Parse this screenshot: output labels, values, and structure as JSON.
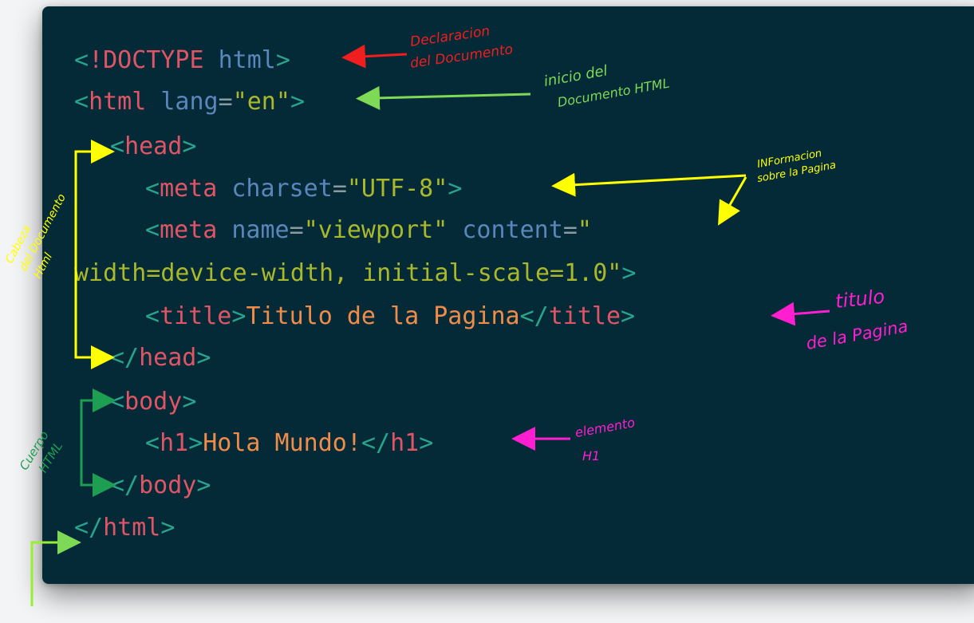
{
  "code_lines": [
    "<!DOCTYPE html>",
    "<html lang=\"en\">",
    "<head>",
    "<meta charset=\"UTF-8\">",
    "<meta name=\"viewport\" content=\"",
    "width=device-width, initial-scale=1.0\">",
    "<title>Titulo de la Pagina</title>",
    "</head>",
    "<body>",
    "<h1>Hola Mundo!</h1>",
    "</body>",
    "</html>"
  ],
  "annotations": {
    "doctype": [
      "Declaracion",
      "del Documento"
    ],
    "html_start": [
      "inicio del",
      "Documento HTML"
    ],
    "meta_info": [
      "INFormacion",
      "sobre la Pagina"
    ],
    "title_note": [
      "titulo",
      "de la Pagina"
    ],
    "h1_note": [
      "elemento",
      "H1"
    ],
    "head_note": [
      "Cabeza",
      "del Documento",
      "Html"
    ],
    "body_note": [
      "Cuerpo",
      "HTML"
    ]
  },
  "colors": {
    "background": "#042a37",
    "bracket": "#28a48f",
    "tag": "#e05565",
    "attribute": "#5a86bb",
    "string": "#aab82b",
    "text": "#f08c4a",
    "ink_red": "#f01e1e",
    "ink_green": "#7ed957",
    "ink_yellow": "#ffff00",
    "ink_magenta": "#ff1fd0",
    "ink_darkgreen": "#1e9e52"
  }
}
